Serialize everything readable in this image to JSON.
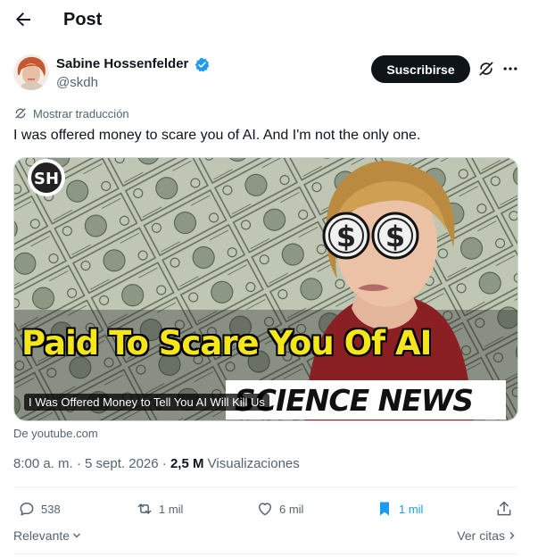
{
  "header": {
    "title": "Post"
  },
  "author": {
    "name": "Sabine Hossenfelder",
    "handle": "@skdh"
  },
  "actions_top": {
    "subscribe_label": "Suscribirse"
  },
  "translate": {
    "label": "Mostrar traducción"
  },
  "tweet": {
    "text": "I was offered money to scare you of AI. And I'm not the only one."
  },
  "media": {
    "logo_text": "SH",
    "headline": "Paid To Scare You Of AI",
    "channel_text": "SCIENCE NEWS",
    "caption": "I Was Offered Money to Tell You AI Will Kill Us",
    "source": "De youtube.com"
  },
  "meta": {
    "time": "8:00 a. m.",
    "separator": " · ",
    "date": "5 sept. 2026",
    "views_count": "2,5 M",
    "views_label": "Visualizaciones"
  },
  "engagement": {
    "replies": "538",
    "reposts": "1 mil",
    "likes": "6 mil",
    "bookmarks": "1 mil"
  },
  "footer": {
    "sort_label": "Relevante",
    "quotes_label": "Ver citas"
  },
  "colors": {
    "accent": "#1d9bf0",
    "text": "#0f1419",
    "muted": "#536471",
    "headline_yellow": "#f4e61b"
  }
}
